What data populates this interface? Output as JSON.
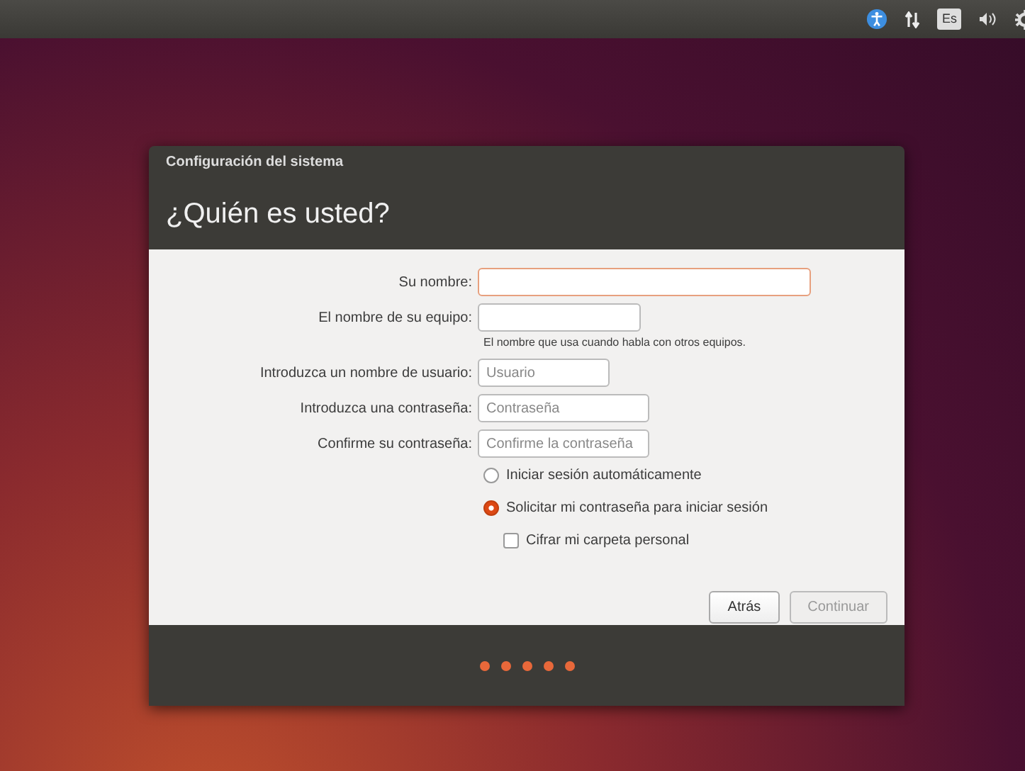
{
  "top_panel": {
    "keyboard_layout": "Es"
  },
  "dialog": {
    "title": "Configuración del sistema",
    "heading": "¿Quién es usted?",
    "fields": [
      {
        "label": "Su nombre:",
        "focused": true
      },
      {
        "label": "El nombre de su equipo:",
        "focused": false,
        "hint": "El nombre que usa cuando habla con otros equipos."
      },
      {
        "label": "Introduzca un nombre de usuario:",
        "placeholder": "Usuario",
        "focused": false
      },
      {
        "label": "Introduzca una contraseña:",
        "placeholder": "Contraseña",
        "focused": false
      },
      {
        "label": "Confirme su contraseña:",
        "placeholder": "Confirme la contraseña",
        "focused": false
      }
    ],
    "login_options": [
      {
        "kind": "radio",
        "label": "Iniciar sesión automáticamente",
        "selected": false
      },
      {
        "kind": "radio",
        "label": "Solicitar mi contraseña para iniciar sesión",
        "selected": true
      },
      {
        "kind": "checkbox",
        "label": "Cifrar mi carpeta personal",
        "checked": false
      }
    ],
    "buttons": [
      {
        "label": "Atrás",
        "disabled": false
      },
      {
        "label": "Continuar",
        "disabled": true
      }
    ]
  }
}
